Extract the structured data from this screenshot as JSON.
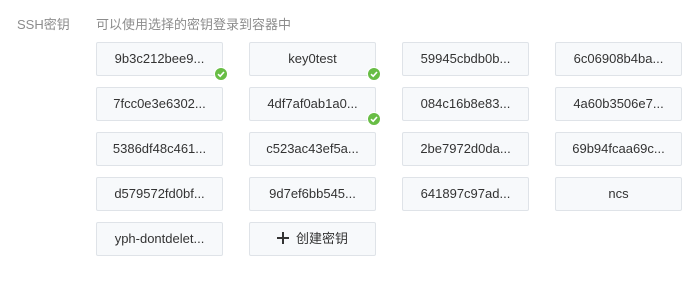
{
  "ssh_field": {
    "label": "SSH密钥",
    "hint": "可以使用选择的密钥登录到容器中"
  },
  "keys": [
    {
      "label": "9b3c212bee9...",
      "selected": true
    },
    {
      "label": "key0test",
      "selected": true
    },
    {
      "label": "59945cbdb0b...",
      "selected": false
    },
    {
      "label": "6c06908b4ba...",
      "selected": false
    },
    {
      "label": "7fcc0e3e6302...",
      "selected": false
    },
    {
      "label": "4df7af0ab1a0...",
      "selected": true
    },
    {
      "label": "084c16b8e83...",
      "selected": false
    },
    {
      "label": "4a60b3506e7...",
      "selected": false
    },
    {
      "label": "5386df48c461...",
      "selected": false
    },
    {
      "label": "c523ac43ef5a...",
      "selected": false
    },
    {
      "label": "2be7972d0da...",
      "selected": false
    },
    {
      "label": "69b94fcaa69c...",
      "selected": false
    },
    {
      "label": "d579572fd0bf...",
      "selected": false
    },
    {
      "label": "9d7ef6bb545...",
      "selected": false
    },
    {
      "label": "641897c97ad...",
      "selected": false
    },
    {
      "label": "ncs",
      "selected": false
    },
    {
      "label": "yph-dontdelet...",
      "selected": false
    }
  ],
  "create_key": {
    "label": "创建密钥",
    "icon": "plus-icon"
  },
  "colors": {
    "selected_check": "#68bd45",
    "card_border": "#dfe3e8",
    "card_bg": "#f7f9fb",
    "muted_text": "#8c8c8c"
  }
}
